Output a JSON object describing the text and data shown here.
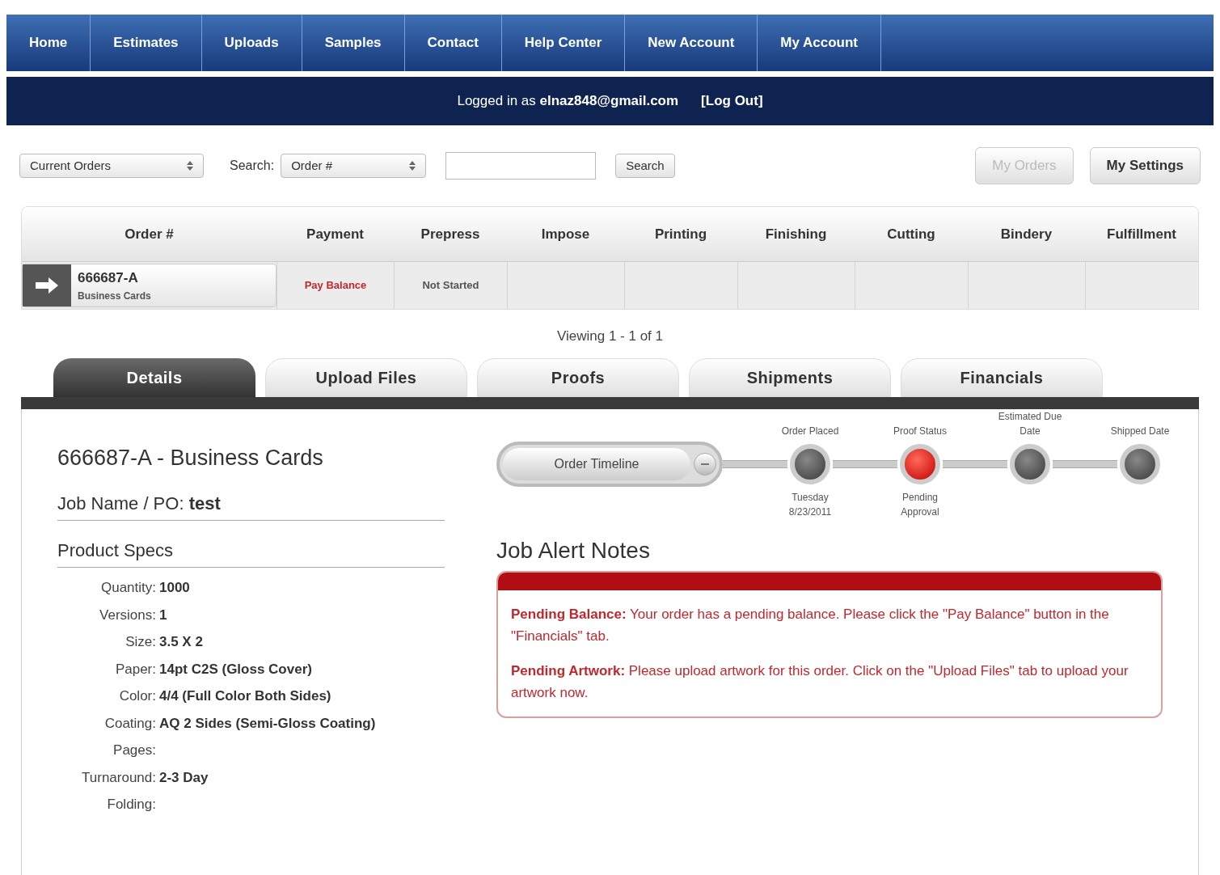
{
  "nav": {
    "items": [
      "Home",
      "Estimates",
      "Uploads",
      "Samples",
      "Contact",
      "Help Center",
      "New Account",
      "My Account"
    ]
  },
  "login_bar": {
    "prefix": "Logged in as",
    "email": "elnaz848@gmail.com",
    "logout": "[Log Out]"
  },
  "toolbar": {
    "filter": "Current Orders",
    "search_label": "Search:",
    "search_by": "Order #",
    "search_button": "Search",
    "buttons": [
      {
        "label": "My Orders",
        "disabled": true
      },
      {
        "label": "My Settings",
        "disabled": false
      }
    ]
  },
  "table": {
    "columns": [
      "Order #",
      "Payment",
      "Prepress",
      "Impose",
      "Printing",
      "Finishing",
      "Cutting",
      "Bindery",
      "Fulfillment"
    ],
    "rows": [
      {
        "cells": [
          {
            "kind": "order",
            "text": "666687-A",
            "subtext": "Business Cards"
          },
          {
            "text": "Pay Balance",
            "kind": "alert"
          },
          {
            "text": "Not Started",
            "kind": "plain"
          },
          {
            "kind": "plain"
          },
          {
            "kind": "plain"
          },
          {
            "kind": "plain"
          },
          {
            "kind": "plain"
          },
          {
            "kind": "plain"
          },
          {
            "kind": "plain"
          }
        ]
      }
    ]
  },
  "pager": "Viewing 1 - 1 of 1",
  "tabs": [
    {
      "label": "Details",
      "selected": true
    },
    {
      "label": "Upload Files",
      "selected": false
    },
    {
      "label": "Proofs",
      "selected": false
    },
    {
      "label": "Shipments",
      "selected": false
    },
    {
      "label": "Financials",
      "selected": false
    }
  ],
  "details": {
    "title": "666687-A - Business Cards",
    "job_name_label": "Job Name / PO:",
    "job_name": "test",
    "specs_title": "Product Specs",
    "specs": [
      {
        "label": "Quantity:",
        "value": "1000"
      },
      {
        "label": "Versions:",
        "value": "1"
      },
      {
        "label": "Size:",
        "value": "3.5 X 2"
      },
      {
        "label": "Paper:",
        "value": "14pt C2S (Gloss Cover)"
      },
      {
        "label": "Color:",
        "value": "4/4 (Full Color Both Sides)"
      },
      {
        "label": "Coating:",
        "value": "AQ 2 Sides (Semi-Gloss Coating)"
      },
      {
        "label": "Pages:"
      },
      {
        "label": "Turnaround:",
        "value": "2-3 Day"
      },
      {
        "label": "Folding:"
      }
    ]
  },
  "timeline": {
    "button": "Order Timeline",
    "steps": [
      {
        "label": "Order Placed",
        "active": false,
        "note": "Tuesday 8/23/2011"
      },
      {
        "label": "Proof Status",
        "active": true,
        "note": "Pending Approval"
      },
      {
        "label": "Estimated Due Date",
        "active": false
      },
      {
        "label": "Shipped Date",
        "active": false
      }
    ]
  },
  "alerts": {
    "title": "Job Alert Notes",
    "notes": [
      {
        "head": "Pending Balance:",
        "text": "Your order has a pending balance. Please click the \"Pay Balance\" button in the \"Financials\" tab."
      },
      {
        "head": "Pending Artwork:",
        "text": "Please upload artwork for this order. Click on the \"Upload Files\" tab to upload your artwork now."
      }
    ]
  }
}
